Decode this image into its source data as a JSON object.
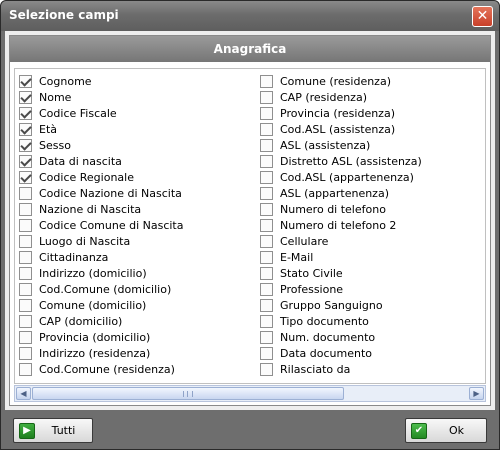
{
  "window": {
    "title": "Selezione campi",
    "close_glyph": "✕"
  },
  "section": {
    "header": "Anagrafica"
  },
  "fields_left": [
    {
      "label": "Cognome",
      "checked": true
    },
    {
      "label": "Nome",
      "checked": true
    },
    {
      "label": "Codice Fiscale",
      "checked": true
    },
    {
      "label": "Età",
      "checked": true
    },
    {
      "label": "Sesso",
      "checked": true
    },
    {
      "label": "Data di nascita",
      "checked": true
    },
    {
      "label": "Codice Regionale",
      "checked": true
    },
    {
      "label": "Codice Nazione di Nascita",
      "checked": false
    },
    {
      "label": "Nazione di Nascita",
      "checked": false
    },
    {
      "label": "Codice Comune di Nascita",
      "checked": false
    },
    {
      "label": "Luogo di Nascita",
      "checked": false
    },
    {
      "label": "Cittadinanza",
      "checked": false
    },
    {
      "label": "Indirizzo (domicilio)",
      "checked": false
    },
    {
      "label": "Cod.Comune (domicilio)",
      "checked": false
    },
    {
      "label": "Comune (domicilio)",
      "checked": false
    },
    {
      "label": "CAP (domicilio)",
      "checked": false
    },
    {
      "label": "Provincia (domicilio)",
      "checked": false
    },
    {
      "label": "Indirizzo (residenza)",
      "checked": false
    },
    {
      "label": "Cod.Comune (residenza)",
      "checked": false
    }
  ],
  "fields_right": [
    {
      "label": "Comune (residenza)",
      "checked": false
    },
    {
      "label": "CAP (residenza)",
      "checked": false
    },
    {
      "label": "Provincia (residenza)",
      "checked": false
    },
    {
      "label": "Cod.ASL (assistenza)",
      "checked": false
    },
    {
      "label": "ASL (assistenza)",
      "checked": false
    },
    {
      "label": "Distretto ASL (assistenza)",
      "checked": false
    },
    {
      "label": "Cod.ASL (appartenenza)",
      "checked": false
    },
    {
      "label": "ASL (appartenenza)",
      "checked": false
    },
    {
      "label": "Numero di telefono",
      "checked": false
    },
    {
      "label": "Numero di telefono 2",
      "checked": false
    },
    {
      "label": "Cellulare",
      "checked": false
    },
    {
      "label": "E-Mail",
      "checked": false
    },
    {
      "label": "Stato Civile",
      "checked": false
    },
    {
      "label": "Professione",
      "checked": false
    },
    {
      "label": "Gruppo Sanguigno",
      "checked": false
    },
    {
      "label": "Tipo documento",
      "checked": false
    },
    {
      "label": "Num. documento",
      "checked": false
    },
    {
      "label": "Data documento",
      "checked": false
    },
    {
      "label": "Rilasciato da",
      "checked": false
    }
  ],
  "footer": {
    "tutti_label": "Tutti",
    "tutti_icon": "select-all-icon",
    "ok_label": "Ok",
    "ok_icon": "checkmark-icon"
  },
  "colors": {
    "frame": "#6e6e6e",
    "close_button": "#c8402a",
    "scrollbar": "#c8d6f0",
    "button_icon": "#1f7f1f"
  }
}
